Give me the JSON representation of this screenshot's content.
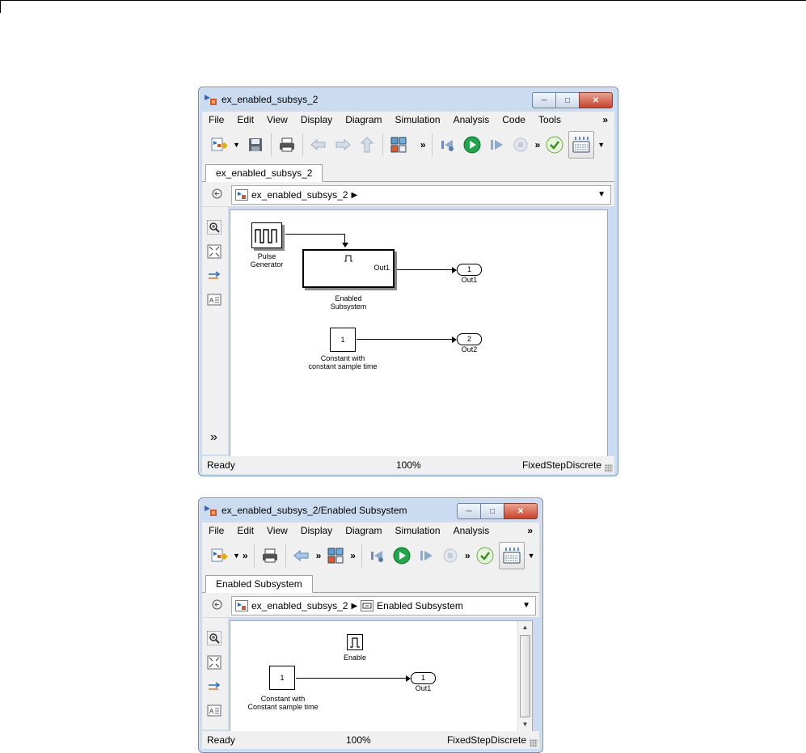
{
  "window1": {
    "title": "ex_enabled_subsys_2",
    "menu": [
      "File",
      "Edit",
      "View",
      "Display",
      "Diagram",
      "Simulation",
      "Analysis",
      "Code",
      "Tools"
    ],
    "menu_more": "»",
    "tab": "ex_enabled_subsys_2",
    "breadcrumb": [
      "ex_enabled_subsys_2"
    ],
    "blocks": {
      "pulse_generator": "Pulse\nGenerator",
      "enabled_subsystem": "Enabled\nSubsystem",
      "enabled_subsystem_port": "Out1",
      "constant_value": "1",
      "constant_label": "Constant with\nconstant sample time",
      "out1_number": "1",
      "out1_label": "Out1",
      "out2_number": "2",
      "out2_label": "Out2"
    },
    "status": {
      "left": "Ready",
      "zoom": "100%",
      "solver": "FixedStepDiscrete"
    },
    "palette_more": "»"
  },
  "window2": {
    "title": "ex_enabled_subsys_2/Enabled Subsystem",
    "menu": [
      "File",
      "Edit",
      "View",
      "Display",
      "Diagram",
      "Simulation",
      "Analysis"
    ],
    "menu_more": "»",
    "tab": "Enabled Subsystem",
    "breadcrumb": [
      "ex_enabled_subsys_2",
      "Enabled Subsystem"
    ],
    "blocks": {
      "enable_label": "Enable",
      "constant_value": "1",
      "constant_label": "Constant with\nConstant sample time",
      "out1_number": "1",
      "out1_label": "Out1"
    },
    "status": {
      "left": "Ready",
      "zoom": "100%",
      "solver": "FixedStepDiscrete"
    }
  },
  "icons": [
    "simulink-logo-icon",
    "new-model-icon",
    "save-icon",
    "print-icon",
    "back-icon",
    "forward-icon",
    "up-icon",
    "library-browser-icon",
    "step-back-icon",
    "run-icon",
    "step-forward-icon",
    "stop-icon",
    "check-icon",
    "build-icon",
    "zoom-icon",
    "fit-icon",
    "arrow-icon",
    "annotation-icon"
  ]
}
